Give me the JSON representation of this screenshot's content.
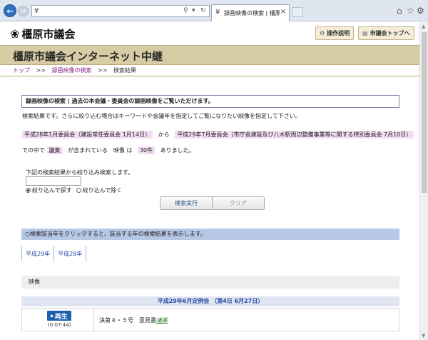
{
  "browser": {
    "address_favicon": "¥",
    "tab_title": "録画映像の検索 | 橿原市議…",
    "tab_favicon": "¥"
  },
  "header": {
    "logo_text": "橿原市議会",
    "help_button": "操作説明",
    "top_button": "市議会トップへ"
  },
  "banner": {
    "title": "橿原市議会インターネット中継"
  },
  "breadcrumb": {
    "items": [
      "トップ",
      "録画映像の検索",
      "検索結果"
    ],
    "separator": ">>"
  },
  "search_info": {
    "heading": "録画映像の検索 | 過去の本会議・委員会の録画映像をご覧いただけます。",
    "result_text": "検索結果です。さらに絞り込む場合はキーワードや会議年を指定してご覧になりたい映像を指定して下さい。",
    "range_start": "平成28年1月委員会（建設常任委員会 1月14日）",
    "from_word": "から",
    "range_end": "平成29年7月委員会（市庁舎建設及び八木駅周辺整備事業等に関する特別委員会 7月10日）",
    "until_word": "ま",
    "within_word": "での中で",
    "keyword": "議案",
    "contains_word": "が含まれている　映像 は",
    "count": "30件",
    "found_word": "ありました。"
  },
  "filter": {
    "label": "下記の検索結果から絞り込み検索します。",
    "input_value": "",
    "option_narrow": "絞り込んで探す",
    "option_exclude": "絞り込んで除く"
  },
  "buttons": {
    "execute": "検索実行",
    "clear": "クリア"
  },
  "year_hint": "○検索該当年をクリックすると、該当する年の検索結果を表示します。",
  "years": [
    "平成29年",
    "平成28年"
  ],
  "videos": {
    "section_label": "映像",
    "session_title": "平成29年6月定例会 （第4日 6月27日）",
    "play_label": "再生",
    "duration": "(0:07:44)",
    "item_prefix": "決第４・５号　意見書",
    "item_keyword": "議案"
  }
}
